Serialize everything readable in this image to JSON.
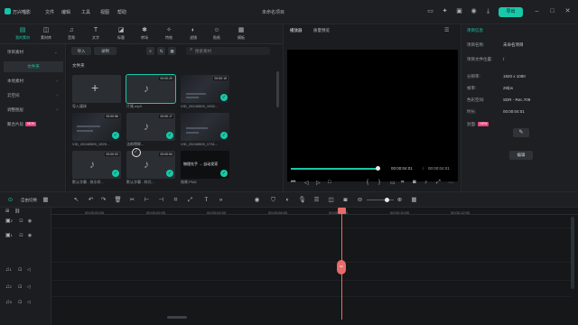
{
  "app": {
    "name": "万兴喵影",
    "project_title": "未命名项目",
    "export_label": "导出"
  },
  "menu": [
    "文件",
    "编辑",
    "工具",
    "视图",
    "帮助"
  ],
  "media_tabs": [
    {
      "label": "我的素材",
      "icon": "folder-icon"
    },
    {
      "label": "素材库",
      "icon": "stock-icon"
    },
    {
      "label": "音频",
      "icon": "music-icon"
    },
    {
      "label": "文字",
      "icon": "text-icon"
    },
    {
      "label": "标题",
      "icon": "title-icon"
    },
    {
      "label": "转场",
      "icon": "transition-icon"
    },
    {
      "label": "特效",
      "icon": "effects-icon"
    },
    {
      "label": "滤镜",
      "icon": "filter-icon"
    },
    {
      "label": "贴纸",
      "icon": "sticker-icon"
    },
    {
      "label": "模板",
      "icon": "template-icon"
    }
  ],
  "sidebar": {
    "items": [
      {
        "label": "项目素材",
        "selected": false,
        "arrow": true
      },
      {
        "label": "文件夹",
        "selected": true,
        "arrow": false
      },
      {
        "label": "本地素材",
        "selected": false,
        "arrow": true
      },
      {
        "label": "云空间",
        "selected": false,
        "arrow": true
      },
      {
        "label": "调整图层",
        "selected": false,
        "arrow": true
      },
      {
        "label": "聚合片段",
        "selected": false,
        "arrow": false,
        "badge": "NEW"
      }
    ]
  },
  "library": {
    "import_label": "导入",
    "record_label": "录制",
    "search_placeholder": "搜索素材",
    "folder_label": "文件夹",
    "items": [
      {
        "kind": "import",
        "caption": "导入媒体",
        "duration": ""
      },
      {
        "kind": "audio",
        "caption": "片尾.mp3",
        "duration": "00:00:20",
        "selected": true
      },
      {
        "kind": "video",
        "caption": "VID_20240509_1932...",
        "duration": "00:00:15"
      },
      {
        "kind": "video",
        "caption": "VID_20240509_1925...",
        "duration": "00:00:56"
      },
      {
        "kind": "audio",
        "caption": "法郎德辉...",
        "duration": "00:00:17"
      },
      {
        "kind": "video",
        "caption": "VID_20240509_1731...",
        "duration": ""
      },
      {
        "kind": "audio",
        "caption": "默认字幕 - 快乐样...",
        "duration": "00:00:02"
      },
      {
        "kind": "audio",
        "caption": "默认字幕 - 样式...",
        "duration": "00:00:54"
      },
      {
        "kind": "image",
        "caption": "效果.PNG",
        "duration": "",
        "overlay_text": "物理先手 → 自动发家"
      }
    ]
  },
  "player": {
    "tabs": [
      "播放器",
      "质量预览"
    ],
    "current_time": "00:00:04:01",
    "total_time": "00:00:04:01",
    "progress": 0.97
  },
  "properties": {
    "title": "项目信息",
    "rows": [
      {
        "label": "项目名称:",
        "value": "未命名项目"
      },
      {
        "label": "项目文件位置:",
        "value": "/"
      },
      {
        "label": "分辨率:",
        "value": "1920 x 1080"
      },
      {
        "label": "帧率:",
        "value": "25fps"
      },
      {
        "label": "色彩空间:",
        "value": "SDR - Rec.709"
      },
      {
        "label": "时长:",
        "value": "00:00:04:01"
      }
    ],
    "watermark_label": "封面:",
    "watermark_badge": "NEW",
    "edit_label": "编辑"
  },
  "timeline": {
    "view_label": "自由切换",
    "ruler": [
      "00:00:00:00",
      "00:00:02:00",
      "00:00:04:00",
      "00:00:06:00",
      "00:00:08:00",
      "00:00:10:00",
      "00:00:12:00"
    ],
    "tracks": [
      {
        "id": "2",
        "kind": "video-track-icon"
      },
      {
        "id": "1",
        "kind": "video-track-icon"
      },
      {
        "id": "1",
        "kind": "audio-track-icon"
      },
      {
        "id": "2",
        "kind": "audio-track-icon"
      },
      {
        "id": "3",
        "kind": "audio-track-icon"
      }
    ],
    "playhead_time": "00:00:04:01"
  },
  "colors": {
    "accent": "#18c8a8",
    "playhead": "#e96a6a",
    "badge": "#e0457a"
  }
}
